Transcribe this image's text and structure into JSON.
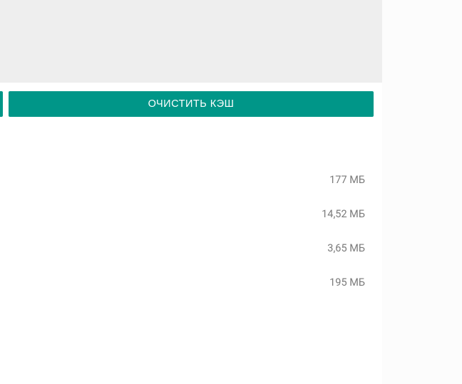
{
  "button": {
    "label": "ОЧИСТИТЬ КЭШ"
  },
  "storage": {
    "rows": [
      {
        "value": "177 МБ"
      },
      {
        "value": "14,52 МБ"
      },
      {
        "value": "3,65 МБ"
      },
      {
        "value": "195 МБ"
      }
    ]
  }
}
